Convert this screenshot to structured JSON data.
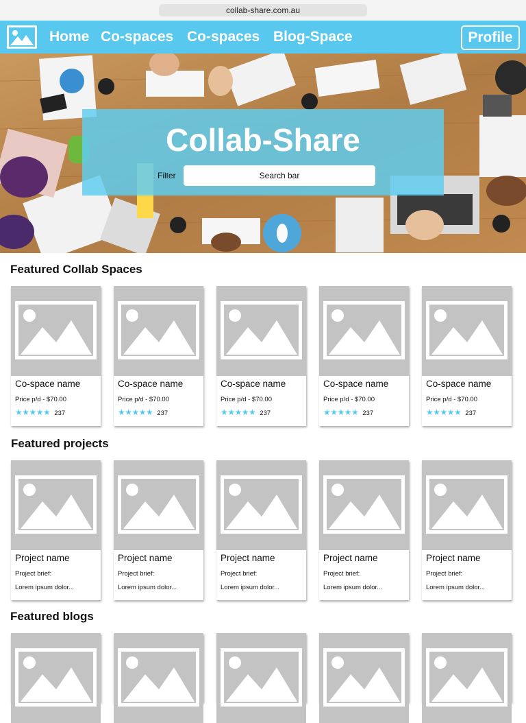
{
  "browser": {
    "url": "collab-share.com.au"
  },
  "nav": {
    "links": [
      "Home",
      "Co-spaces",
      "Co-spaces",
      "Blog-Space"
    ],
    "profile": "Profile",
    "color": "#58c8ef"
  },
  "hero": {
    "title": "Collab-Share",
    "filter_label": "Filter",
    "search_placeholder": "Search bar"
  },
  "sections": {
    "spaces_title": "Featured Collab Spaces",
    "projects_title": "Featured projects",
    "blogs_title": "Featured blogs"
  },
  "spaces": [
    {
      "name": "Co-space name",
      "price": "Price p/d - $70.00",
      "stars": "★★★★★",
      "count": "237"
    },
    {
      "name": "Co-space name",
      "price": "Price p/d - $70.00",
      "stars": "★★★★★",
      "count": "237"
    },
    {
      "name": "Co-space name",
      "price": "Price p/d - $70.00",
      "stars": "★★★★★",
      "count": "237"
    },
    {
      "name": "Co-space name",
      "price": "Price p/d - $70.00",
      "stars": "★★★★★",
      "count": "237"
    },
    {
      "name": "Co-space name",
      "price": "Price p/d - $70.00",
      "stars": "★★★★★",
      "count": "237"
    }
  ],
  "projects": [
    {
      "name": "Project name",
      "brief_label": "Project brief:",
      "brief": "Lorem ipsum dolor..."
    },
    {
      "name": "Project name",
      "brief_label": "Project brief:",
      "brief": "Lorem ipsum dolor..."
    },
    {
      "name": "Project name",
      "brief_label": "Project brief:",
      "brief": "Lorem ipsum dolor..."
    },
    {
      "name": "Project name",
      "brief_label": "Project brief:",
      "brief": "Lorem ipsum dolor..."
    },
    {
      "name": "Project name",
      "brief_label": "Project brief:",
      "brief": "Lorem ipsum dolor..."
    }
  ],
  "blogs_count": 5
}
